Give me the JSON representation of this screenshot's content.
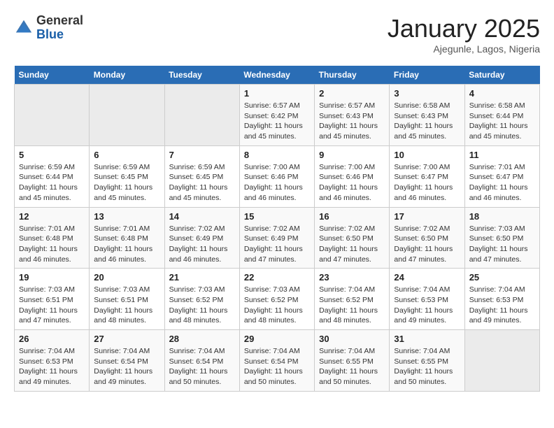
{
  "header": {
    "logo_general": "General",
    "logo_blue": "Blue",
    "month_title": "January 2025",
    "subtitle": "Ajegunle, Lagos, Nigeria"
  },
  "weekdays": [
    "Sunday",
    "Monday",
    "Tuesday",
    "Wednesday",
    "Thursday",
    "Friday",
    "Saturday"
  ],
  "weeks": [
    [
      {
        "day": "",
        "sunrise": "",
        "sunset": "",
        "daylight": "",
        "empty": true
      },
      {
        "day": "",
        "sunrise": "",
        "sunset": "",
        "daylight": "",
        "empty": true
      },
      {
        "day": "",
        "sunrise": "",
        "sunset": "",
        "daylight": "",
        "empty": true
      },
      {
        "day": "1",
        "sunrise": "Sunrise: 6:57 AM",
        "sunset": "Sunset: 6:42 PM",
        "daylight": "Daylight: 11 hours and 45 minutes."
      },
      {
        "day": "2",
        "sunrise": "Sunrise: 6:57 AM",
        "sunset": "Sunset: 6:43 PM",
        "daylight": "Daylight: 11 hours and 45 minutes."
      },
      {
        "day": "3",
        "sunrise": "Sunrise: 6:58 AM",
        "sunset": "Sunset: 6:43 PM",
        "daylight": "Daylight: 11 hours and 45 minutes."
      },
      {
        "day": "4",
        "sunrise": "Sunrise: 6:58 AM",
        "sunset": "Sunset: 6:44 PM",
        "daylight": "Daylight: 11 hours and 45 minutes."
      }
    ],
    [
      {
        "day": "5",
        "sunrise": "Sunrise: 6:59 AM",
        "sunset": "Sunset: 6:44 PM",
        "daylight": "Daylight: 11 hours and 45 minutes."
      },
      {
        "day": "6",
        "sunrise": "Sunrise: 6:59 AM",
        "sunset": "Sunset: 6:45 PM",
        "daylight": "Daylight: 11 hours and 45 minutes."
      },
      {
        "day": "7",
        "sunrise": "Sunrise: 6:59 AM",
        "sunset": "Sunset: 6:45 PM",
        "daylight": "Daylight: 11 hours and 45 minutes."
      },
      {
        "day": "8",
        "sunrise": "Sunrise: 7:00 AM",
        "sunset": "Sunset: 6:46 PM",
        "daylight": "Daylight: 11 hours and 46 minutes."
      },
      {
        "day": "9",
        "sunrise": "Sunrise: 7:00 AM",
        "sunset": "Sunset: 6:46 PM",
        "daylight": "Daylight: 11 hours and 46 minutes."
      },
      {
        "day": "10",
        "sunrise": "Sunrise: 7:00 AM",
        "sunset": "Sunset: 6:47 PM",
        "daylight": "Daylight: 11 hours and 46 minutes."
      },
      {
        "day": "11",
        "sunrise": "Sunrise: 7:01 AM",
        "sunset": "Sunset: 6:47 PM",
        "daylight": "Daylight: 11 hours and 46 minutes."
      }
    ],
    [
      {
        "day": "12",
        "sunrise": "Sunrise: 7:01 AM",
        "sunset": "Sunset: 6:48 PM",
        "daylight": "Daylight: 11 hours and 46 minutes."
      },
      {
        "day": "13",
        "sunrise": "Sunrise: 7:01 AM",
        "sunset": "Sunset: 6:48 PM",
        "daylight": "Daylight: 11 hours and 46 minutes."
      },
      {
        "day": "14",
        "sunrise": "Sunrise: 7:02 AM",
        "sunset": "Sunset: 6:49 PM",
        "daylight": "Daylight: 11 hours and 46 minutes."
      },
      {
        "day": "15",
        "sunrise": "Sunrise: 7:02 AM",
        "sunset": "Sunset: 6:49 PM",
        "daylight": "Daylight: 11 hours and 47 minutes."
      },
      {
        "day": "16",
        "sunrise": "Sunrise: 7:02 AM",
        "sunset": "Sunset: 6:50 PM",
        "daylight": "Daylight: 11 hours and 47 minutes."
      },
      {
        "day": "17",
        "sunrise": "Sunrise: 7:02 AM",
        "sunset": "Sunset: 6:50 PM",
        "daylight": "Daylight: 11 hours and 47 minutes."
      },
      {
        "day": "18",
        "sunrise": "Sunrise: 7:03 AM",
        "sunset": "Sunset: 6:50 PM",
        "daylight": "Daylight: 11 hours and 47 minutes."
      }
    ],
    [
      {
        "day": "19",
        "sunrise": "Sunrise: 7:03 AM",
        "sunset": "Sunset: 6:51 PM",
        "daylight": "Daylight: 11 hours and 47 minutes."
      },
      {
        "day": "20",
        "sunrise": "Sunrise: 7:03 AM",
        "sunset": "Sunset: 6:51 PM",
        "daylight": "Daylight: 11 hours and 48 minutes."
      },
      {
        "day": "21",
        "sunrise": "Sunrise: 7:03 AM",
        "sunset": "Sunset: 6:52 PM",
        "daylight": "Daylight: 11 hours and 48 minutes."
      },
      {
        "day": "22",
        "sunrise": "Sunrise: 7:03 AM",
        "sunset": "Sunset: 6:52 PM",
        "daylight": "Daylight: 11 hours and 48 minutes."
      },
      {
        "day": "23",
        "sunrise": "Sunrise: 7:04 AM",
        "sunset": "Sunset: 6:52 PM",
        "daylight": "Daylight: 11 hours and 48 minutes."
      },
      {
        "day": "24",
        "sunrise": "Sunrise: 7:04 AM",
        "sunset": "Sunset: 6:53 PM",
        "daylight": "Daylight: 11 hours and 49 minutes."
      },
      {
        "day": "25",
        "sunrise": "Sunrise: 7:04 AM",
        "sunset": "Sunset: 6:53 PM",
        "daylight": "Daylight: 11 hours and 49 minutes."
      }
    ],
    [
      {
        "day": "26",
        "sunrise": "Sunrise: 7:04 AM",
        "sunset": "Sunset: 6:53 PM",
        "daylight": "Daylight: 11 hours and 49 minutes."
      },
      {
        "day": "27",
        "sunrise": "Sunrise: 7:04 AM",
        "sunset": "Sunset: 6:54 PM",
        "daylight": "Daylight: 11 hours and 49 minutes."
      },
      {
        "day": "28",
        "sunrise": "Sunrise: 7:04 AM",
        "sunset": "Sunset: 6:54 PM",
        "daylight": "Daylight: 11 hours and 50 minutes."
      },
      {
        "day": "29",
        "sunrise": "Sunrise: 7:04 AM",
        "sunset": "Sunset: 6:54 PM",
        "daylight": "Daylight: 11 hours and 50 minutes."
      },
      {
        "day": "30",
        "sunrise": "Sunrise: 7:04 AM",
        "sunset": "Sunset: 6:55 PM",
        "daylight": "Daylight: 11 hours and 50 minutes."
      },
      {
        "day": "31",
        "sunrise": "Sunrise: 7:04 AM",
        "sunset": "Sunset: 6:55 PM",
        "daylight": "Daylight: 11 hours and 50 minutes."
      },
      {
        "day": "",
        "sunrise": "",
        "sunset": "",
        "daylight": "",
        "empty": true
      }
    ]
  ]
}
